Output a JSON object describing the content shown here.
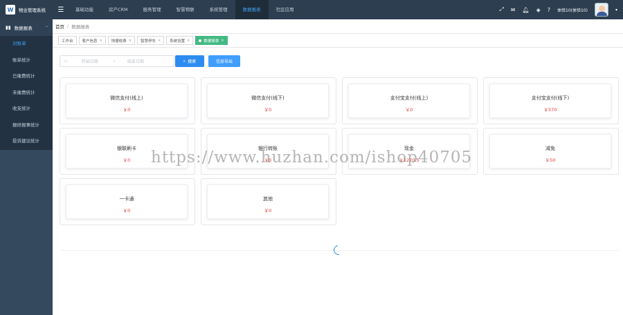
{
  "app": {
    "title": "物业管理系统",
    "logo_text": "W"
  },
  "topnav": [
    {
      "label": "基础功能"
    },
    {
      "label": "房产CRM"
    },
    {
      "label": "服务管理"
    },
    {
      "label": "智慧物联"
    },
    {
      "label": "系统管理"
    },
    {
      "label": "数据报表",
      "active": true
    },
    {
      "label": "社区应用"
    }
  ],
  "user": {
    "name": "体验10(体验10)"
  },
  "sidebar": {
    "section_label": "数据报表",
    "items": [
      {
        "label": "对账单",
        "active": true
      },
      {
        "label": "账单统计"
      },
      {
        "label": "已催费统计"
      },
      {
        "label": "未催费统计"
      },
      {
        "label": "收支统计"
      },
      {
        "label": "报修报事统计"
      },
      {
        "label": "投诉建议统计"
      }
    ]
  },
  "breadcrumb": {
    "home": "首页",
    "separator": "/",
    "current": "数据报表"
  },
  "tabs": [
    {
      "label": "工作台"
    },
    {
      "label": "客户信息"
    },
    {
      "label": "快捷收费"
    },
    {
      "label": "智慧停车"
    },
    {
      "label": "系统设置"
    },
    {
      "label": "数据报表",
      "active": true
    }
  ],
  "search": {
    "start_placeholder": "开始日期",
    "end_placeholder": "结束日期",
    "separator": "-",
    "search_label": "搜索",
    "export_label": "信息导出"
  },
  "cards": [
    {
      "title": "微信支付(线上)",
      "value": "￥0"
    },
    {
      "title": "微信支付(线下)",
      "value": "￥0"
    },
    {
      "title": "支付宝支付(线上)",
      "value": "￥0"
    },
    {
      "title": "支付宝支付(线下)",
      "value": "￥570"
    },
    {
      "title": "银联刷卡",
      "value": "￥0"
    },
    {
      "title": "银行转账",
      "value": "￥0"
    },
    {
      "title": "现金",
      "value": "￥1270.5"
    },
    {
      "title": "减免",
      "value": "￥50"
    },
    {
      "title": "一卡通",
      "value": "￥0"
    },
    {
      "title": "其他",
      "value": "￥0"
    }
  ],
  "watermark": "https://www.huzhan.com/ishop40705",
  "colors": {
    "topbar": "#2c3e50",
    "sidebar": "#34495e",
    "accent": "#2d8cf0",
    "tab_active": "#42b983",
    "value_red": "#e53935"
  }
}
